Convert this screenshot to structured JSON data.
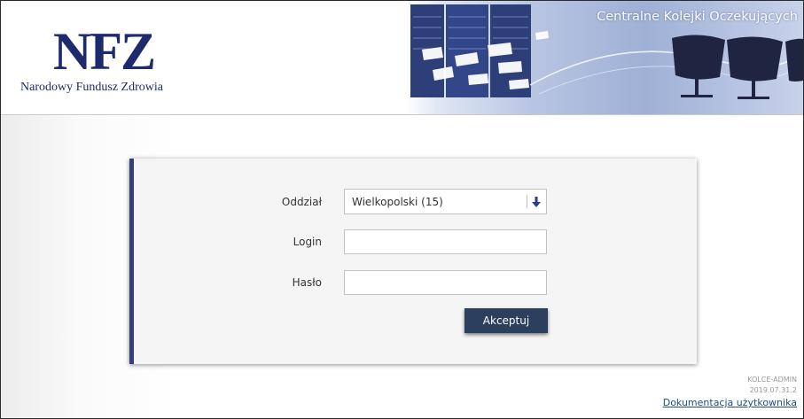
{
  "header": {
    "logo_mark": "NFZ",
    "logo_subtitle": "Narodowy Fundusz Zdrowia",
    "banner_title": "Centralne Kolejki Oczekujących"
  },
  "form": {
    "branch_label": "Oddział",
    "branch_value": "Wielkopolski (15)",
    "login_label": "Login",
    "login_value": "",
    "password_label": "Hasło",
    "password_value": "",
    "submit_label": "Akceptuj"
  },
  "footer": {
    "system_name": "KOLCE-ADMIN",
    "version": "2019.07.31.2",
    "docs_link": "Dokumentacja użytkownika"
  },
  "colors": {
    "brand_navy": "#1e2a6e",
    "card_accent": "#363f78",
    "button_bg": "#2c3f5c",
    "link": "#1f4e8c"
  },
  "icons": {
    "select_arrow": "arrow-down-icon"
  }
}
